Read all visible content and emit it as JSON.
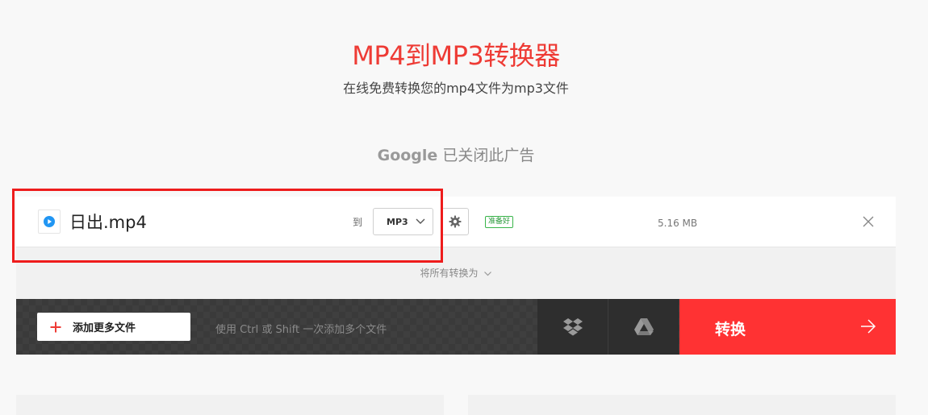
{
  "header": {
    "title": "MP4到MP3转换器",
    "subtitle": "在线免费转换您的mp4文件为mp3文件"
  },
  "ad": {
    "brand": "Google",
    "text": "已关闭此广告"
  },
  "file": {
    "icon": "play-circle-icon",
    "name": "日出.mp4",
    "to_label": "到",
    "format": "MP3",
    "status": "准备好",
    "size": "5.16 MB"
  },
  "convert_all": {
    "label": "将所有转换为"
  },
  "actions": {
    "add_more_label": "添加更多文件",
    "hint": "使用 Ctrl 或 Shift 一次添加多个文件",
    "convert_label": "转换"
  },
  "colors": {
    "accent": "#ff3233",
    "title": "#ee3b35",
    "status_green": "#39b54a",
    "play_blue": "#2196f3"
  }
}
